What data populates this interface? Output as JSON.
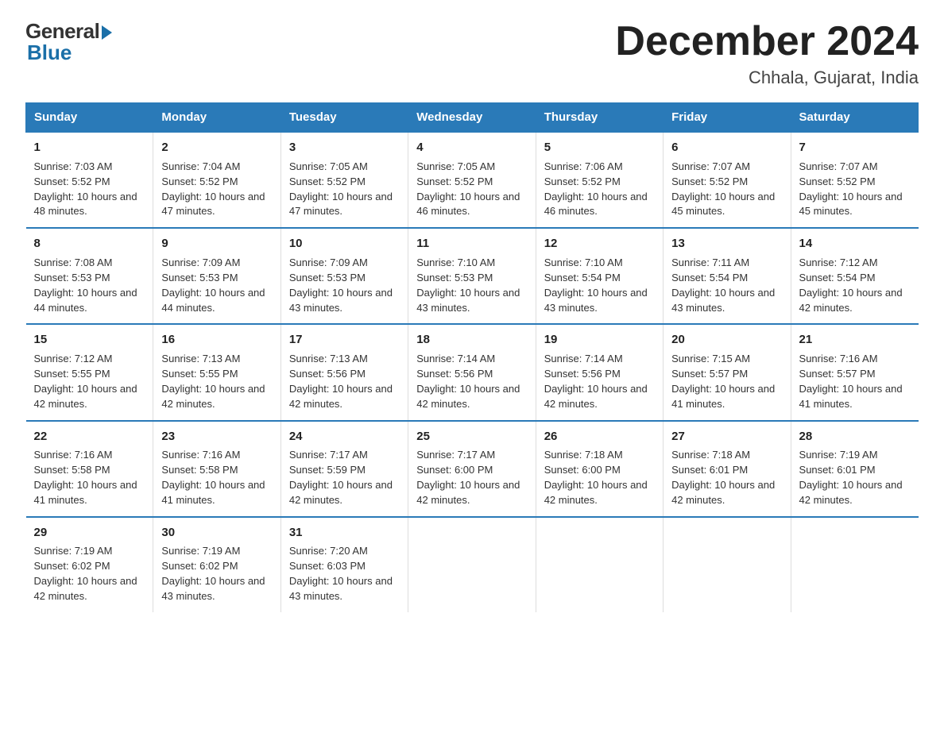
{
  "header": {
    "logo_general": "General",
    "logo_blue": "Blue",
    "month_title": "December 2024",
    "location": "Chhala, Gujarat, India"
  },
  "days_of_week": [
    "Sunday",
    "Monday",
    "Tuesday",
    "Wednesday",
    "Thursday",
    "Friday",
    "Saturday"
  ],
  "weeks": [
    [
      {
        "day": "1",
        "sunrise": "7:03 AM",
        "sunset": "5:52 PM",
        "daylight": "10 hours and 48 minutes."
      },
      {
        "day": "2",
        "sunrise": "7:04 AM",
        "sunset": "5:52 PM",
        "daylight": "10 hours and 47 minutes."
      },
      {
        "day": "3",
        "sunrise": "7:05 AM",
        "sunset": "5:52 PM",
        "daylight": "10 hours and 47 minutes."
      },
      {
        "day": "4",
        "sunrise": "7:05 AM",
        "sunset": "5:52 PM",
        "daylight": "10 hours and 46 minutes."
      },
      {
        "day": "5",
        "sunrise": "7:06 AM",
        "sunset": "5:52 PM",
        "daylight": "10 hours and 46 minutes."
      },
      {
        "day": "6",
        "sunrise": "7:07 AM",
        "sunset": "5:52 PM",
        "daylight": "10 hours and 45 minutes."
      },
      {
        "day": "7",
        "sunrise": "7:07 AM",
        "sunset": "5:52 PM",
        "daylight": "10 hours and 45 minutes."
      }
    ],
    [
      {
        "day": "8",
        "sunrise": "7:08 AM",
        "sunset": "5:53 PM",
        "daylight": "10 hours and 44 minutes."
      },
      {
        "day": "9",
        "sunrise": "7:09 AM",
        "sunset": "5:53 PM",
        "daylight": "10 hours and 44 minutes."
      },
      {
        "day": "10",
        "sunrise": "7:09 AM",
        "sunset": "5:53 PM",
        "daylight": "10 hours and 43 minutes."
      },
      {
        "day": "11",
        "sunrise": "7:10 AM",
        "sunset": "5:53 PM",
        "daylight": "10 hours and 43 minutes."
      },
      {
        "day": "12",
        "sunrise": "7:10 AM",
        "sunset": "5:54 PM",
        "daylight": "10 hours and 43 minutes."
      },
      {
        "day": "13",
        "sunrise": "7:11 AM",
        "sunset": "5:54 PM",
        "daylight": "10 hours and 43 minutes."
      },
      {
        "day": "14",
        "sunrise": "7:12 AM",
        "sunset": "5:54 PM",
        "daylight": "10 hours and 42 minutes."
      }
    ],
    [
      {
        "day": "15",
        "sunrise": "7:12 AM",
        "sunset": "5:55 PM",
        "daylight": "10 hours and 42 minutes."
      },
      {
        "day": "16",
        "sunrise": "7:13 AM",
        "sunset": "5:55 PM",
        "daylight": "10 hours and 42 minutes."
      },
      {
        "day": "17",
        "sunrise": "7:13 AM",
        "sunset": "5:56 PM",
        "daylight": "10 hours and 42 minutes."
      },
      {
        "day": "18",
        "sunrise": "7:14 AM",
        "sunset": "5:56 PM",
        "daylight": "10 hours and 42 minutes."
      },
      {
        "day": "19",
        "sunrise": "7:14 AM",
        "sunset": "5:56 PM",
        "daylight": "10 hours and 42 minutes."
      },
      {
        "day": "20",
        "sunrise": "7:15 AM",
        "sunset": "5:57 PM",
        "daylight": "10 hours and 41 minutes."
      },
      {
        "day": "21",
        "sunrise": "7:16 AM",
        "sunset": "5:57 PM",
        "daylight": "10 hours and 41 minutes."
      }
    ],
    [
      {
        "day": "22",
        "sunrise": "7:16 AM",
        "sunset": "5:58 PM",
        "daylight": "10 hours and 41 minutes."
      },
      {
        "day": "23",
        "sunrise": "7:16 AM",
        "sunset": "5:58 PM",
        "daylight": "10 hours and 41 minutes."
      },
      {
        "day": "24",
        "sunrise": "7:17 AM",
        "sunset": "5:59 PM",
        "daylight": "10 hours and 42 minutes."
      },
      {
        "day": "25",
        "sunrise": "7:17 AM",
        "sunset": "6:00 PM",
        "daylight": "10 hours and 42 minutes."
      },
      {
        "day": "26",
        "sunrise": "7:18 AM",
        "sunset": "6:00 PM",
        "daylight": "10 hours and 42 minutes."
      },
      {
        "day": "27",
        "sunrise": "7:18 AM",
        "sunset": "6:01 PM",
        "daylight": "10 hours and 42 minutes."
      },
      {
        "day": "28",
        "sunrise": "7:19 AM",
        "sunset": "6:01 PM",
        "daylight": "10 hours and 42 minutes."
      }
    ],
    [
      {
        "day": "29",
        "sunrise": "7:19 AM",
        "sunset": "6:02 PM",
        "daylight": "10 hours and 42 minutes."
      },
      {
        "day": "30",
        "sunrise": "7:19 AM",
        "sunset": "6:02 PM",
        "daylight": "10 hours and 43 minutes."
      },
      {
        "day": "31",
        "sunrise": "7:20 AM",
        "sunset": "6:03 PM",
        "daylight": "10 hours and 43 minutes."
      },
      {
        "day": "",
        "sunrise": "",
        "sunset": "",
        "daylight": ""
      },
      {
        "day": "",
        "sunrise": "",
        "sunset": "",
        "daylight": ""
      },
      {
        "day": "",
        "sunrise": "",
        "sunset": "",
        "daylight": ""
      },
      {
        "day": "",
        "sunrise": "",
        "sunset": "",
        "daylight": ""
      }
    ]
  ]
}
